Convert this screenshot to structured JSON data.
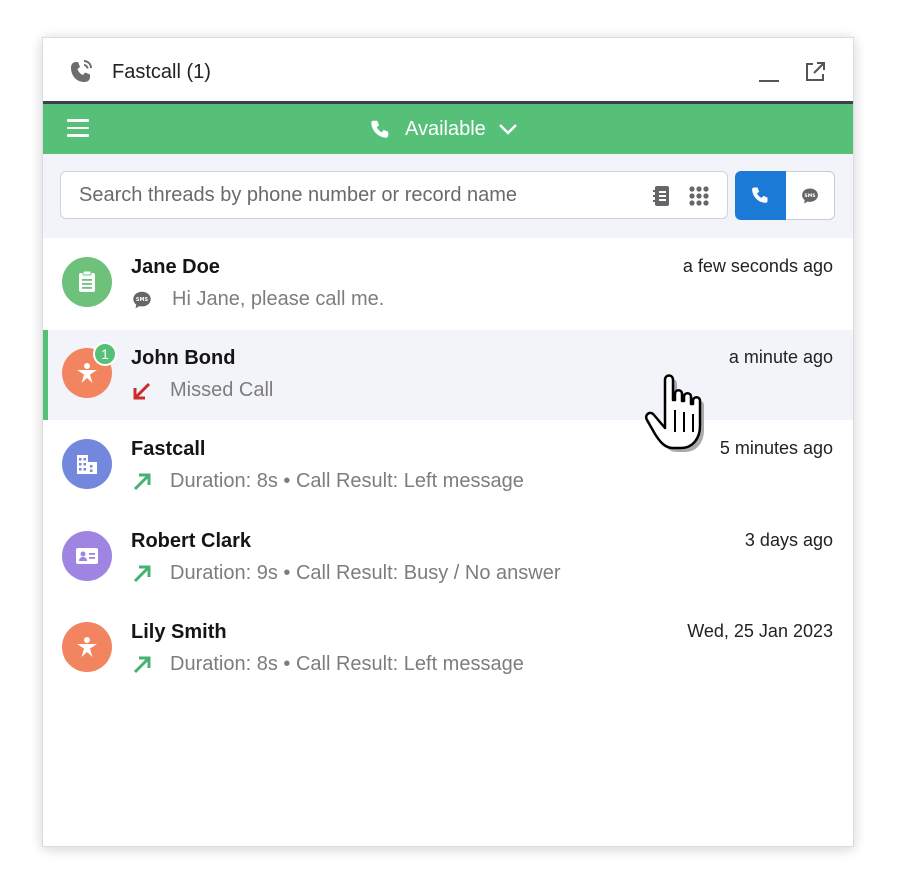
{
  "titlebar": {
    "title": "Fastcall (1)",
    "icon": "phone-ringing-icon",
    "minimize_icon": "minimize-icon",
    "popout_icon": "popout-icon"
  },
  "status": {
    "menu_icon": "hamburger-icon",
    "label": "Available",
    "icon": "phone-icon",
    "dropdown_icon": "chevron-down-icon",
    "color": "#56c079"
  },
  "search": {
    "placeholder": "Search threads by phone number or record name",
    "value": "",
    "contacts_icon": "contacts-book-icon",
    "dialpad_icon": "dialpad-icon",
    "call_mode_icon": "phone-icon",
    "sms_mode_icon": "sms-bubble-icon",
    "call_mode_color": "#1b7ad6"
  },
  "threads": [
    {
      "name": "Jane Doe",
      "time": "a few seconds ago",
      "detail": "Hi Jane, please call me.",
      "type_icon": "sms-bubble-icon",
      "avatar_icon": "clipboard-icon",
      "avatar_color": "#6ec17b"
    },
    {
      "name": "John Bond",
      "time": "a minute ago",
      "detail": "Missed Call",
      "type_icon": "missed-call-arrow-icon",
      "avatar_icon": "person-star-icon",
      "avatar_color": "#f2845f",
      "badge": "1"
    },
    {
      "name": "Fastcall",
      "time": "5 minutes ago",
      "detail": "Duration: 8s • Call Result: Left message",
      "type_icon": "outgoing-call-arrow-icon",
      "avatar_icon": "building-icon",
      "avatar_color": "#7387dc"
    },
    {
      "name": "Robert Clark",
      "time": "3 days ago",
      "detail": "Duration: 9s • Call Result: Busy / No answer",
      "type_icon": "outgoing-call-arrow-icon",
      "avatar_icon": "contact-card-icon",
      "avatar_color": "#9f84e2"
    },
    {
      "name": "Lily Smith",
      "time": "Wed, 25 Jan 2023",
      "detail": "Duration: 8s • Call Result: Left message",
      "type_icon": "outgoing-call-arrow-icon",
      "avatar_icon": "person-star-icon",
      "avatar_color": "#f2845f"
    }
  ],
  "colors": {
    "missed": "#cc2b2b",
    "outgoing": "#49b073",
    "active_row": "#f2f4f9"
  }
}
